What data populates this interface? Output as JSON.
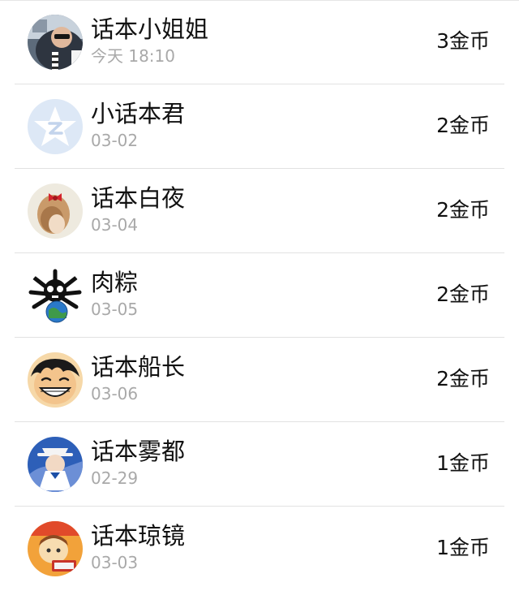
{
  "rows": [
    {
      "name": "话本小姐姐",
      "date": "今天 18:10",
      "coins": "3金币",
      "avatar": "photo-man-sunglasses-avatar"
    },
    {
      "name": "小话本君",
      "date": "03-02",
      "coins": "2金币",
      "avatar": "qzone-star-avatar"
    },
    {
      "name": "话本白夜",
      "date": "03-04",
      "coins": "2金币",
      "avatar": "girl-red-bow-avatar"
    },
    {
      "name": "肉粽",
      "date": "03-05",
      "coins": "2金币",
      "avatar": "skull-globe-avatar"
    },
    {
      "name": "话本船长",
      "date": "03-06",
      "coins": "2金币",
      "avatar": "luffy-cartoon-avatar"
    },
    {
      "name": "话本雾都",
      "date": "02-29",
      "coins": "1金币",
      "avatar": "kaito-kid-avatar"
    },
    {
      "name": "话本琼镜",
      "date": "03-03",
      "coins": "1金币",
      "avatar": "orange-cartoon-avatar"
    }
  ]
}
